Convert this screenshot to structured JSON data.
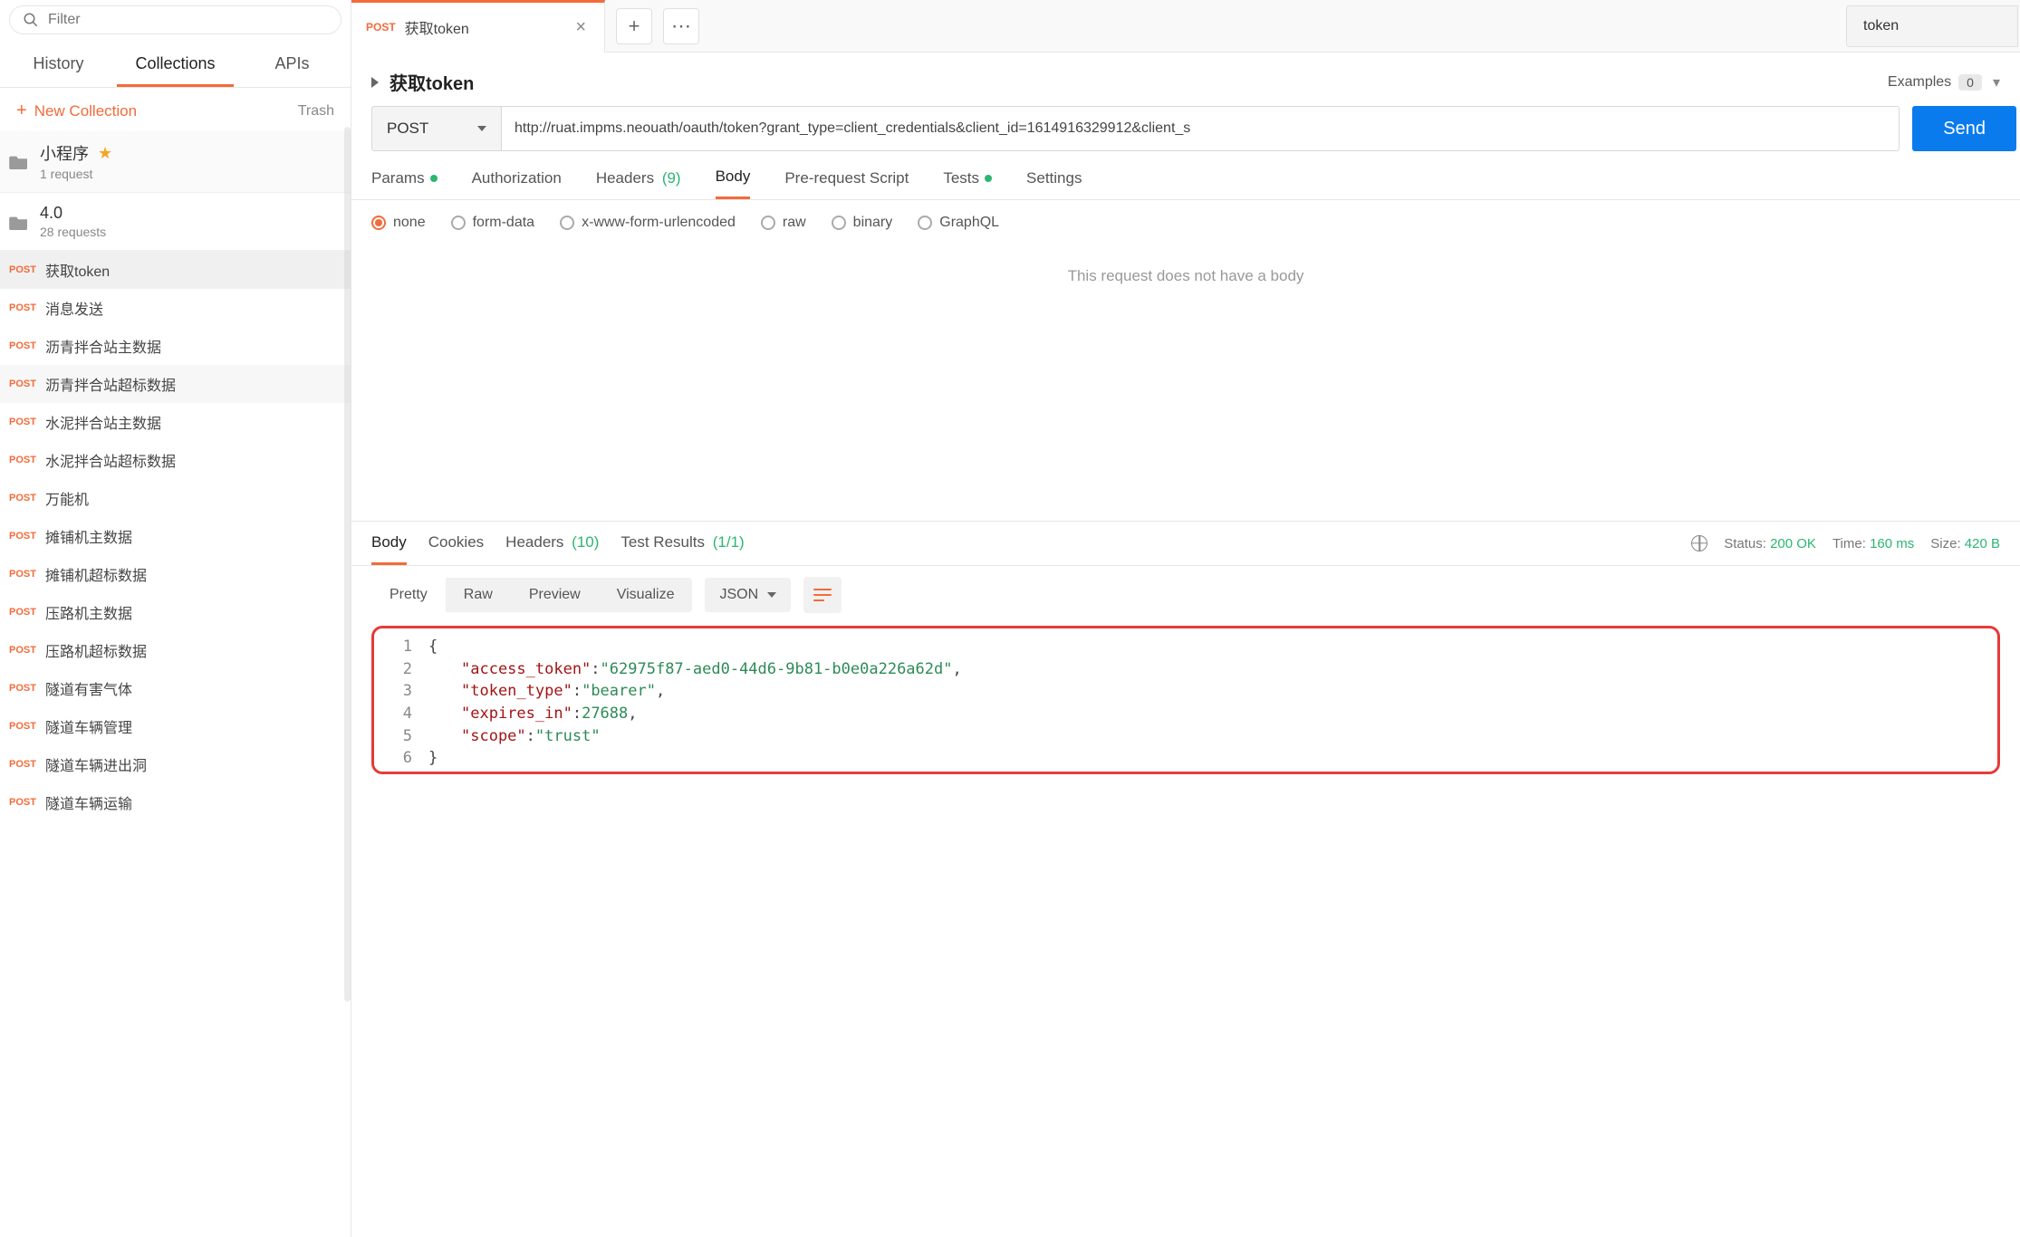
{
  "sidebar": {
    "search_placeholder": "Filter",
    "tabs": {
      "history": "History",
      "collections": "Collections",
      "apis": "APIs"
    },
    "new_collection": "New Collection",
    "trash": "Trash",
    "collections": [
      {
        "name": "小程序",
        "sub": "1 request",
        "starred": true
      },
      {
        "name": "4.0",
        "sub": "28 requests",
        "starred": false
      }
    ],
    "requests": [
      {
        "method": "POST",
        "title": "获取token",
        "selected": true
      },
      {
        "method": "POST",
        "title": "消息发送"
      },
      {
        "method": "POST",
        "title": "沥青拌合站主数据"
      },
      {
        "method": "POST",
        "title": "沥青拌合站超标数据",
        "alt": true
      },
      {
        "method": "POST",
        "title": "水泥拌合站主数据"
      },
      {
        "method": "POST",
        "title": "水泥拌合站超标数据"
      },
      {
        "method": "POST",
        "title": "万能机"
      },
      {
        "method": "POST",
        "title": "摊铺机主数据"
      },
      {
        "method": "POST",
        "title": "摊铺机超标数据"
      },
      {
        "method": "POST",
        "title": "压路机主数据"
      },
      {
        "method": "POST",
        "title": "压路机超标数据"
      },
      {
        "method": "POST",
        "title": "隧道有害气体"
      },
      {
        "method": "POST",
        "title": "隧道车辆管理"
      },
      {
        "method": "POST",
        "title": "隧道车辆进出洞"
      },
      {
        "method": "POST",
        "title": "隧道车辆运输"
      }
    ]
  },
  "env": {
    "name": "token"
  },
  "tab": {
    "method": "POST",
    "title": "获取token"
  },
  "header": {
    "name": "获取token",
    "examples_label": "Examples",
    "examples_count": "0"
  },
  "url": {
    "method": "POST",
    "value": "http://ruat.impms.neouath/oauth/token?grant_type=client_credentials&client_id=1614916329912&client_s"
  },
  "send": "Send",
  "req_tabs": {
    "params": "Params",
    "auth": "Authorization",
    "headers": "Headers",
    "headers_count": "(9)",
    "body": "Body",
    "prereq": "Pre-request Script",
    "tests": "Tests",
    "settings": "Settings"
  },
  "body_types": {
    "none": "none",
    "form_data": "form-data",
    "urlencoded": "x-www-form-urlencoded",
    "raw": "raw",
    "binary": "binary",
    "graphql": "GraphQL"
  },
  "body_empty": "This request does not have a body",
  "resp_tabs": {
    "body": "Body",
    "cookies": "Cookies",
    "headers": "Headers",
    "headers_count": "(10)",
    "tests": "Test Results",
    "tests_count": "(1/1)"
  },
  "resp_meta": {
    "status_label": "Status:",
    "status_val": "200 OK",
    "time_label": "Time:",
    "time_val": "160 ms",
    "size_label": "Size:",
    "size_val": "420 B"
  },
  "views": {
    "pretty": "Pretty",
    "raw": "Raw",
    "preview": "Preview",
    "visualize": "Visualize",
    "format": "JSON"
  },
  "response_json": {
    "access_token": "62975f87-aed0-44d6-9b81-b0e0a226a62d",
    "token_type": "bearer",
    "expires_in": 27688,
    "scope": "trust"
  }
}
